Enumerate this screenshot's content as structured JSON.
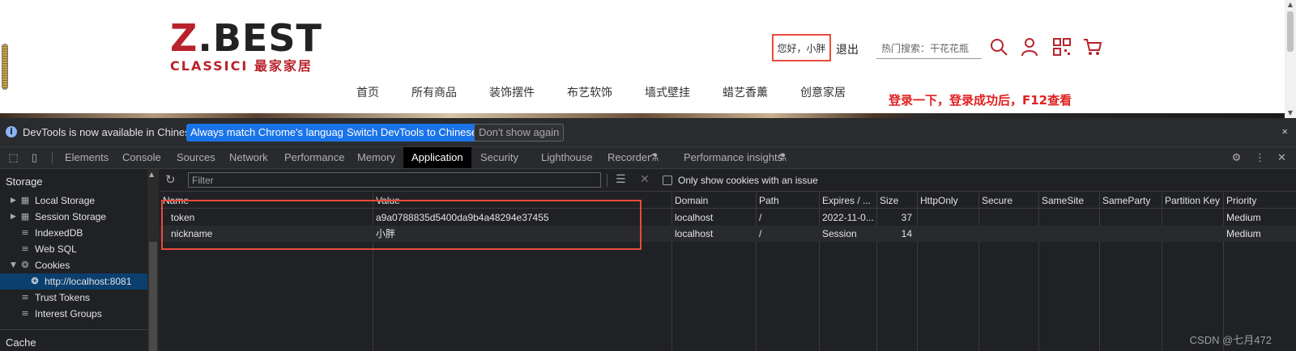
{
  "site": {
    "logo_big_prefix": "Z",
    "logo_big_rest": ".BEST",
    "logo_small": "CLASSICI 最家家居",
    "greeting": "您好，小胖",
    "logout": "退出",
    "hot_search": "热门搜索：干花花瓶",
    "nav": [
      "首页",
      "所有商品",
      "装饰摆件",
      "布艺软饰",
      "墙式壁挂",
      "蜡艺香薰",
      "创意家居"
    ],
    "annotation": "登录一下，登录成功后，F12查看",
    "icons": [
      "search-icon",
      "user-icon",
      "qrcode-icon",
      "cart-icon"
    ]
  },
  "infobar": {
    "text": "DevTools is now available in Chinese!",
    "btn_match": "Always match Chrome's language",
    "btn_switch": "Switch DevTools to Chinese",
    "btn_dismiss": "Don't show again",
    "close": "×"
  },
  "tabs": [
    "Elements",
    "Console",
    "Sources",
    "Network",
    "Performance",
    "Memory",
    "Application",
    "Security",
    "Lighthouse",
    "Recorder",
    "Performance insights"
  ],
  "active_tab": "Application",
  "sidebar": {
    "storage_heading": "Storage",
    "items": [
      {
        "label": "Local Storage",
        "icon": "grid-icon",
        "arrow": "▶"
      },
      {
        "label": "Session Storage",
        "icon": "grid-icon",
        "arrow": "▶"
      },
      {
        "label": "IndexedDB",
        "icon": "database-icon",
        "arrow": ""
      },
      {
        "label": "Web SQL",
        "icon": "database-icon",
        "arrow": ""
      },
      {
        "label": "Cookies",
        "icon": "cookie-icon",
        "arrow": "▼"
      },
      {
        "label": "http://localhost:8081",
        "icon": "cookie-icon",
        "arrow": ""
      },
      {
        "label": "Trust Tokens",
        "icon": "database-icon",
        "arrow": ""
      },
      {
        "label": "Interest Groups",
        "icon": "database-icon",
        "arrow": ""
      }
    ],
    "selected": "http://localhost:8081",
    "cache_heading": "Cache"
  },
  "toolbar": {
    "filter_placeholder": "Filter",
    "only_issues_label": "Only show cookies with an issue"
  },
  "cookies_table": {
    "columns": [
      "Name",
      "Value",
      "Domain",
      "Path",
      "Expires / ...",
      "Size",
      "HttpOnly",
      "Secure",
      "SameSite",
      "SameParty",
      "Partition Key",
      "Priority"
    ],
    "rows": [
      [
        "token",
        "a9a0788835d5400da9b4a48294e37455",
        "localhost",
        "/",
        "2022-11-0...",
        "37",
        "",
        "",
        "",
        "",
        "",
        "Medium"
      ],
      [
        "nickname",
        "小胖",
        "localhost",
        "/",
        "Session",
        "14",
        "",
        "",
        "",
        "",
        "",
        "Medium"
      ]
    ]
  },
  "watermark": "CSDN @七月472",
  "colors": {
    "annotation_red": "#e84b3c",
    "brand_red": "#b8232b",
    "devtools_bg": "#202124",
    "selected_blue": "#0a3f6e",
    "button_blue": "#1a73e8"
  }
}
